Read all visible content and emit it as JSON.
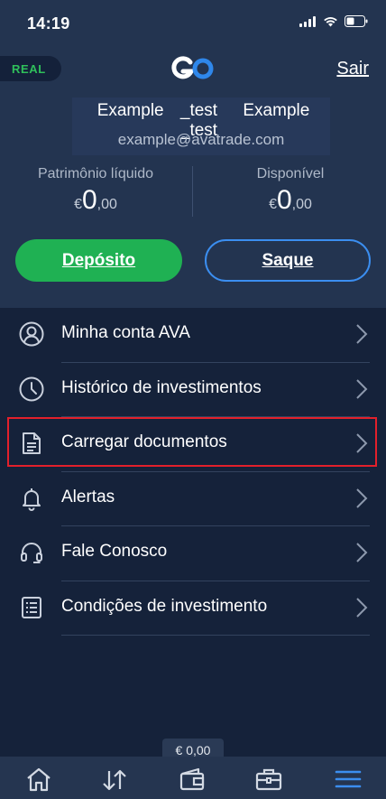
{
  "status_bar": {
    "time": "14:19"
  },
  "header": {
    "account_type": "REAL",
    "logo_text": "GO",
    "logout_label": "Sair"
  },
  "user": {
    "first_name": "Example",
    "last_name": "_test",
    "first_name_2": "Example",
    "last_name_2": "_test",
    "email": "example@avatrade.com"
  },
  "balances": {
    "equity": {
      "label": "Patrimônio líquido",
      "currency": "€",
      "integer": "0",
      "decimal": ",00"
    },
    "available": {
      "label": "Disponível",
      "currency": "€",
      "integer": "0",
      "decimal": ",00"
    }
  },
  "actions": {
    "deposit_label": "Depósito",
    "withdraw_label": "Saque"
  },
  "menu": {
    "items": [
      {
        "label": "Minha conta AVA",
        "icon": "user-circle-icon"
      },
      {
        "label": "Histórico de investimentos",
        "icon": "clock-icon"
      },
      {
        "label": "Carregar documentos",
        "icon": "document-icon",
        "highlighted": true
      },
      {
        "label": "Alertas",
        "icon": "bell-icon"
      },
      {
        "label": "Fale Conosco",
        "icon": "headset-icon"
      },
      {
        "label": "Condições de investimento",
        "icon": "list-document-icon"
      }
    ]
  },
  "footer": {
    "balance_chip": "€ 0,00",
    "tabs": [
      "home-icon",
      "trade-arrows-icon",
      "wallet-icon",
      "briefcase-icon",
      "menu-icon"
    ],
    "active_tab": "menu-icon"
  },
  "colors": {
    "background": "#15223a",
    "header": "#233450",
    "deposit_green": "#1fb153",
    "withdraw_border": "#3b8ef0",
    "highlight_red": "#e2202b",
    "active_tab_blue": "#3b8ef0",
    "real_badge_green": "#2fbf5b"
  }
}
